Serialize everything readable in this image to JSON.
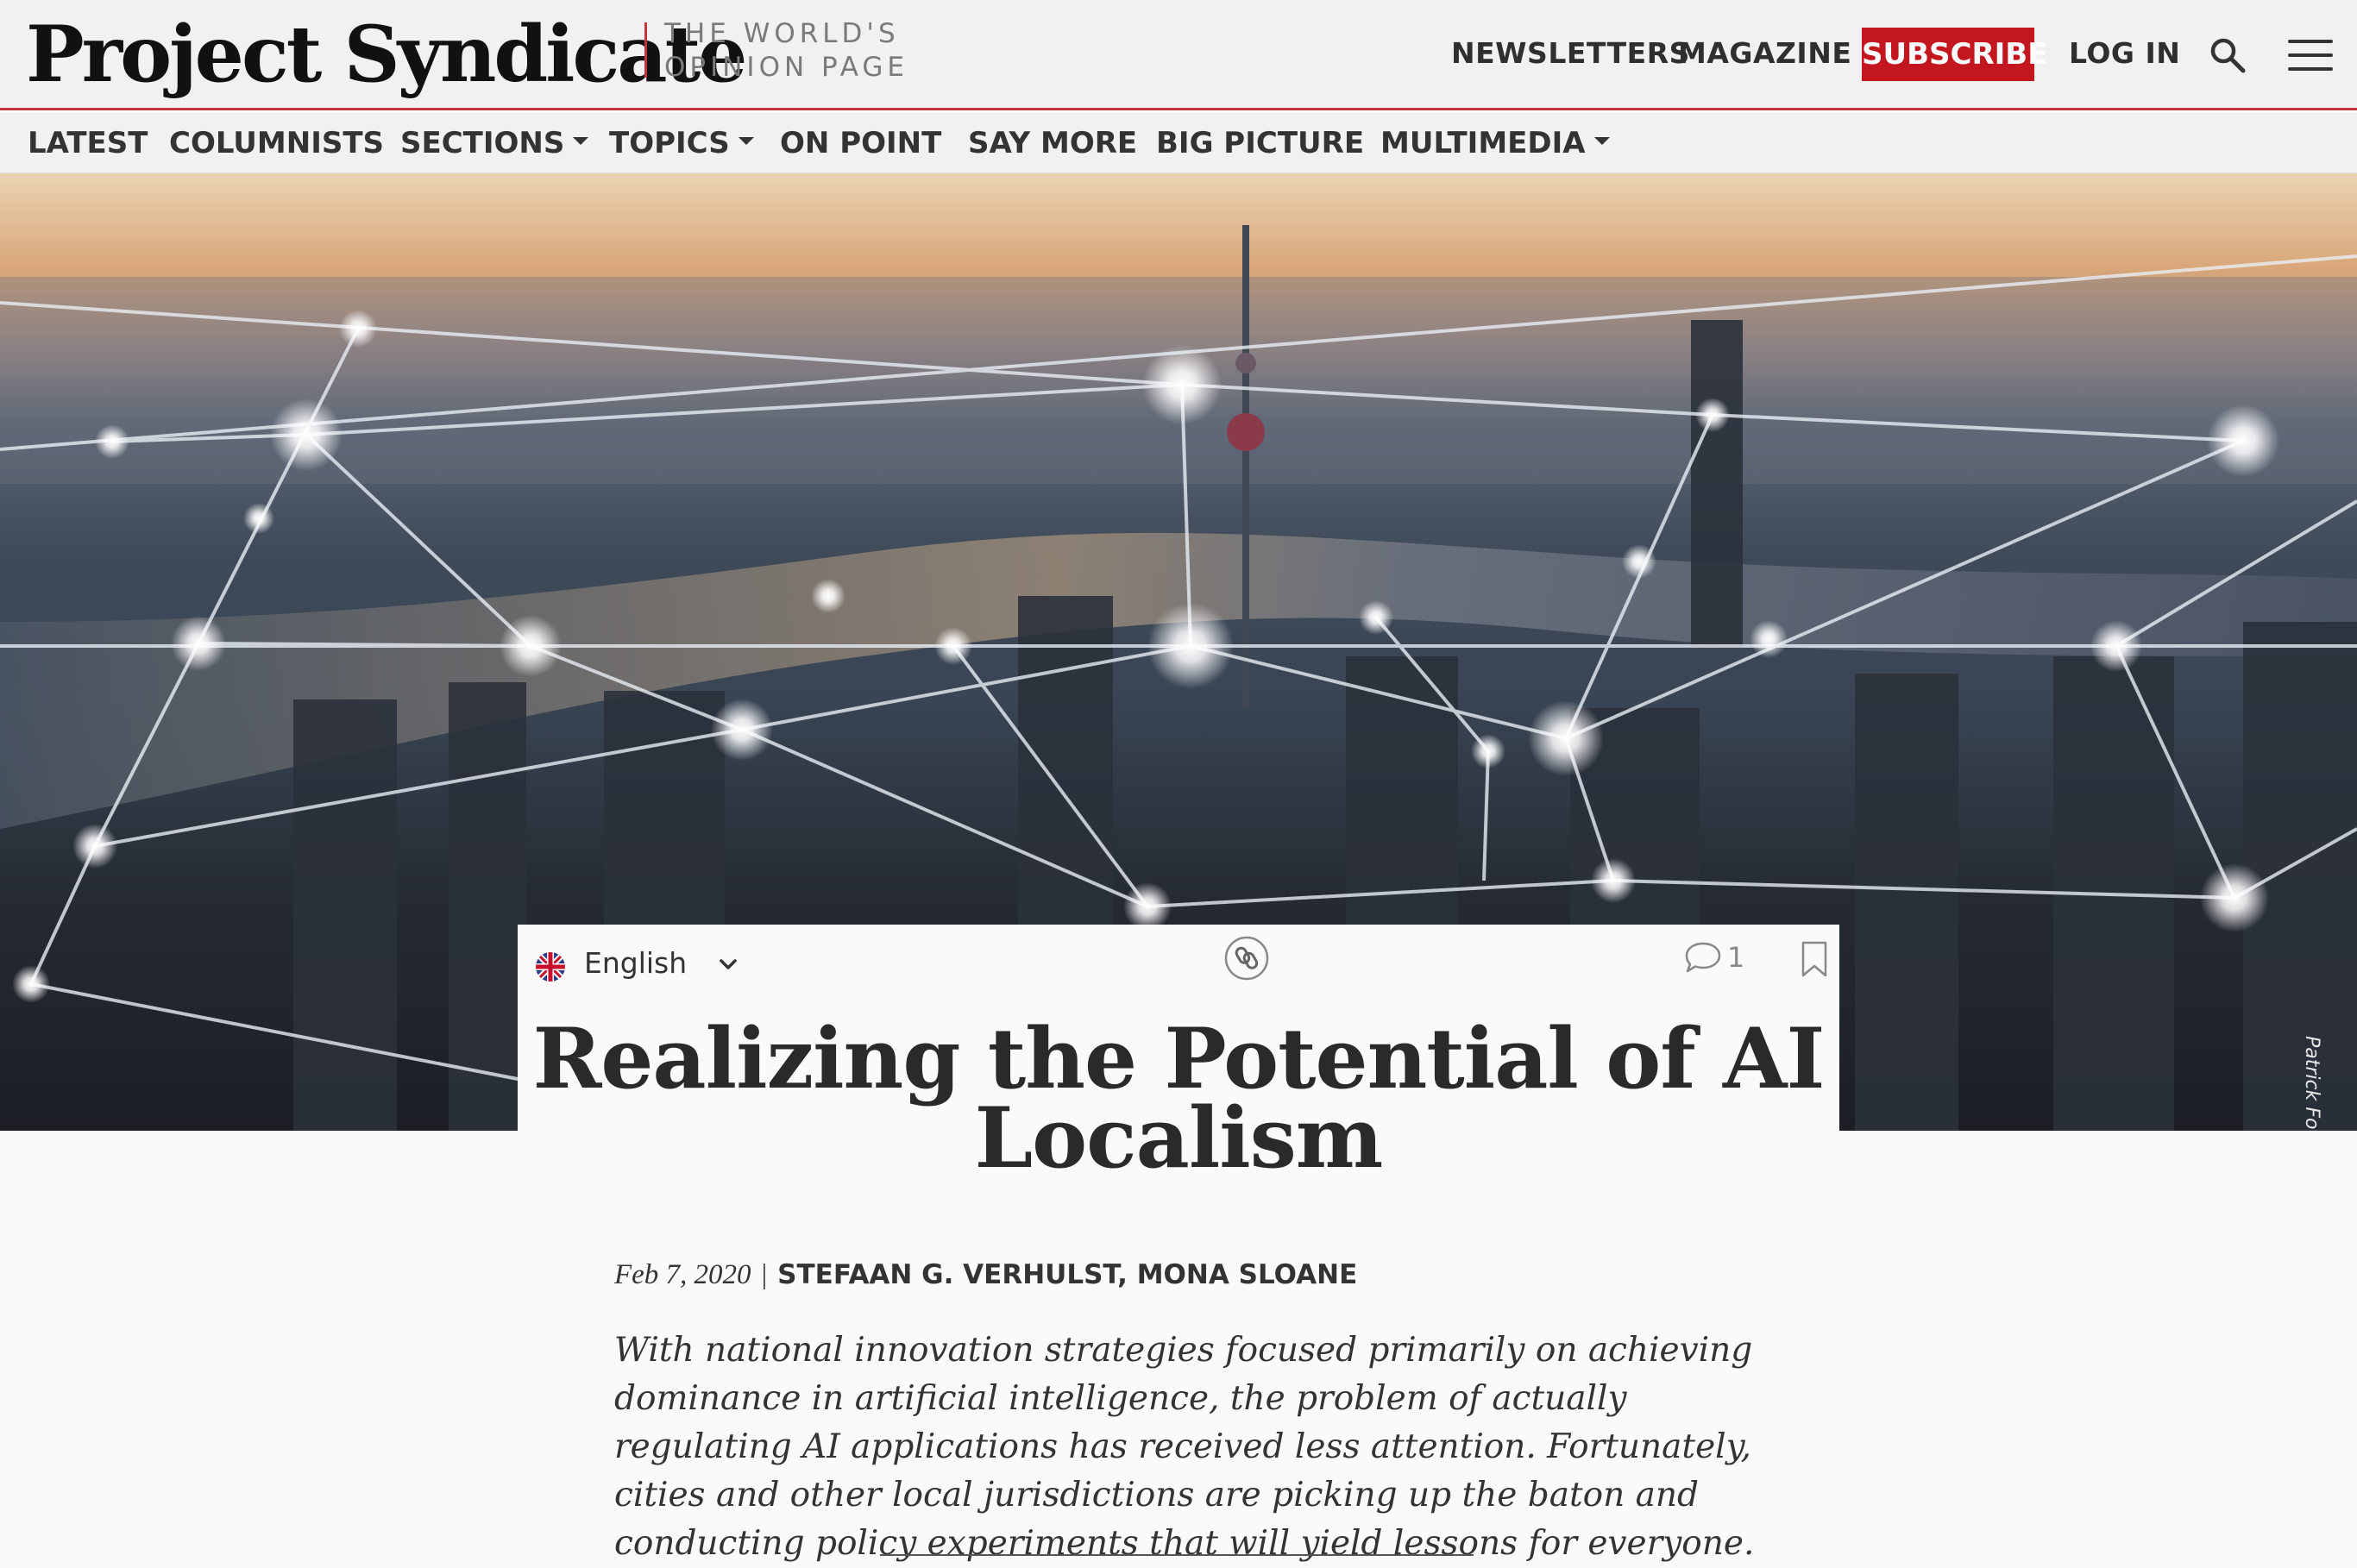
{
  "header": {
    "logo": "Project Syndicate",
    "tagline_line1": "THE WORLD'S",
    "tagline_line2": "OPINION PAGE",
    "links": {
      "newsletters": "NEWSLETTERS",
      "magazine": "MAGAZINE",
      "subscribe": "SUBSCRIBE",
      "login": "LOG IN"
    },
    "icons": {
      "search": "search-icon",
      "menu": "hamburger-menu-icon"
    },
    "accent_color": "#c4161e"
  },
  "nav": {
    "latest": "LATEST",
    "columnists": "COLUMNISTS",
    "sections": "SECTIONS",
    "topics": "TOPICS",
    "on_point": "ON POINT",
    "say_more": "SAY MORE",
    "big_picture": "BIG PICTURE",
    "multimedia": "MULTIMEDIA"
  },
  "hero": {
    "photo_credit": "Patrick Foto/Getty Images"
  },
  "article": {
    "language": "English",
    "comment_count": "1",
    "title_line1": "Realizing the Potential of AI",
    "title_line2": "Localism",
    "date": "Feb 7, 2020",
    "separator": "|",
    "authors": "STEFAAN G. VERHULST, MONA SLOANE",
    "dek": "With national innovation strategies focused primarily on achieving dominance in artificial intelligence, the problem of actually regulating AI applications has received less attention. Fortunately, cities and other local jurisdictions are picking up the baton and conducting policy experiments that will yield lessons for everyone."
  }
}
